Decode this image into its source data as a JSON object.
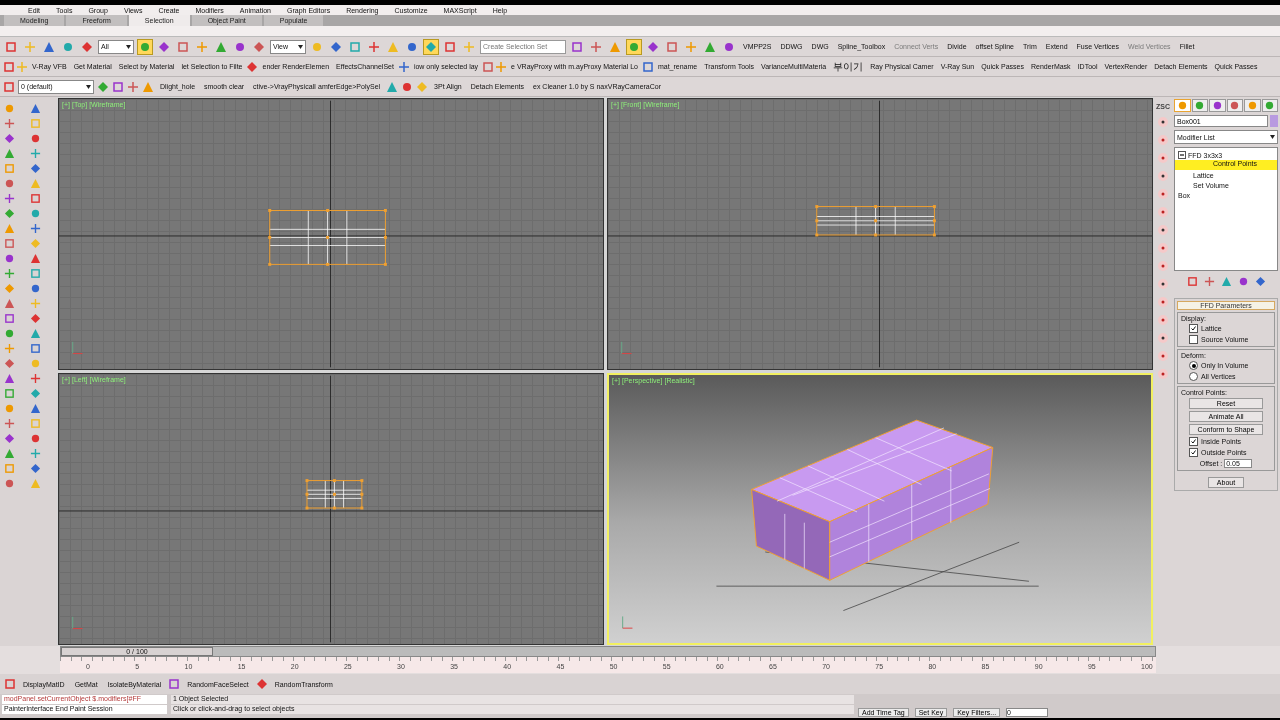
{
  "menu": [
    "Edit",
    "Tools",
    "Group",
    "Views",
    "Create",
    "Modifiers",
    "Animation",
    "Graph Editors",
    "Rendering",
    "Customize",
    "MAXScript",
    "Help"
  ],
  "ribbon_tabs": [
    {
      "label": "Modeling",
      "selected": false
    },
    {
      "label": "Freeform",
      "selected": false
    },
    {
      "label": "Selection",
      "selected": true
    },
    {
      "label": "Object Paint",
      "selected": false
    },
    {
      "label": "Populate",
      "selected": false
    }
  ],
  "main_toolbar": [
    {
      "kind": "icon",
      "selected": false
    },
    {
      "kind": "icon",
      "selected": false
    },
    {
      "kind": "icon",
      "selected": false
    },
    {
      "kind": "icon",
      "selected": false
    },
    {
      "kind": "icon",
      "selected": false
    },
    {
      "kind": "dropdown",
      "value": "All"
    },
    {
      "kind": "icon",
      "selected": true
    },
    {
      "kind": "icon",
      "selected": false
    },
    {
      "kind": "icon",
      "selected": false
    },
    {
      "kind": "icon",
      "selected": false
    },
    {
      "kind": "icon",
      "selected": false
    },
    {
      "kind": "icon",
      "selected": false
    },
    {
      "kind": "icon",
      "selected": false
    },
    {
      "kind": "dropdown",
      "value": "View"
    },
    {
      "kind": "icon",
      "selected": false
    },
    {
      "kind": "icon",
      "selected": false
    },
    {
      "kind": "icon",
      "selected": false
    },
    {
      "kind": "icon",
      "selected": false
    },
    {
      "kind": "icon",
      "selected": false
    },
    {
      "kind": "icon",
      "selected": false
    },
    {
      "kind": "icon",
      "selected": true
    },
    {
      "kind": "icon",
      "selected": false
    },
    {
      "kind": "icon",
      "selected": false
    },
    {
      "kind": "field",
      "placeholder": "Create Selection Set"
    },
    {
      "kind": "icon",
      "selected": false
    },
    {
      "kind": "icon",
      "selected": false
    },
    {
      "kind": "icon",
      "selected": false
    },
    {
      "kind": "icon",
      "selected": true
    },
    {
      "kind": "icon",
      "selected": false
    },
    {
      "kind": "icon",
      "selected": false
    },
    {
      "kind": "icon",
      "selected": false
    },
    {
      "kind": "icon",
      "selected": false
    },
    {
      "kind": "icon",
      "selected": false
    },
    {
      "kind": "button",
      "label": "VMPP2S",
      "disabled": false
    },
    {
      "kind": "button",
      "label": "DDWG",
      "disabled": false
    },
    {
      "kind": "button",
      "label": "DWG",
      "disabled": false
    },
    {
      "kind": "button",
      "label": "Spline_Toolbox",
      "disabled": false
    },
    {
      "kind": "button",
      "label": "Connect Verts",
      "disabled": true
    },
    {
      "kind": "button",
      "label": "Divide",
      "disabled": false
    },
    {
      "kind": "button",
      "label": "offset Spline",
      "disabled": false
    },
    {
      "kind": "button",
      "label": "Trim",
      "disabled": false
    },
    {
      "kind": "button",
      "label": "Extend",
      "disabled": false
    },
    {
      "kind": "button",
      "label": "Fuse Vertices",
      "disabled": false
    },
    {
      "kind": "button",
      "label": "Weld Vertices",
      "disabled": true
    },
    {
      "kind": "button",
      "label": "Fillet",
      "disabled": false
    }
  ],
  "script_toolbar": [
    {
      "kind": "icon"
    },
    {
      "kind": "icon"
    },
    {
      "kind": "button",
      "label": "V-Ray VFB"
    },
    {
      "kind": "button",
      "label": "Get Material"
    },
    {
      "kind": "button",
      "label": "Select by Material"
    },
    {
      "kind": "button",
      "label": "let Selection to Filte"
    },
    {
      "kind": "icon"
    },
    {
      "kind": "button",
      "label": "ender RenderElemen"
    },
    {
      "kind": "button",
      "label": "EffectsChannelSet"
    },
    {
      "kind": "icon"
    },
    {
      "kind": "button",
      "label": "iow only selected lay"
    },
    {
      "kind": "icon"
    },
    {
      "kind": "icon"
    },
    {
      "kind": "button",
      "label": "e VRayProxy with m.ayProxy Material Lo"
    },
    {
      "kind": "icon"
    },
    {
      "kind": "button",
      "label": "mat_rename"
    },
    {
      "kind": "button",
      "label": "Transform Tools"
    },
    {
      "kind": "button",
      "label": "VarianceMultiMateria"
    },
    {
      "kind": "button",
      "label": "부이기"
    },
    {
      "kind": "button",
      "label": "Ray Physical Camer"
    },
    {
      "kind": "button",
      "label": "V-Ray Sun"
    },
    {
      "kind": "button",
      "label": "Quick Passes"
    },
    {
      "kind": "button",
      "label": "RenderMask"
    },
    {
      "kind": "button",
      "label": "IDTool"
    },
    {
      "kind": "button",
      "label": "VertexRender"
    },
    {
      "kind": "button",
      "label": "Detach Elements"
    },
    {
      "kind": "button",
      "label": "Quick Passes"
    }
  ],
  "layer_toolbar": [
    {
      "kind": "icon"
    },
    {
      "kind": "dropdown",
      "value": "0 (default)"
    },
    {
      "kind": "icon"
    },
    {
      "kind": "icon"
    },
    {
      "kind": "icon"
    },
    {
      "kind": "icon"
    },
    {
      "kind": "button",
      "label": "Dlight_hole"
    },
    {
      "kind": "button",
      "label": "smooth clear"
    },
    {
      "kind": "button",
      "label": "ctive->VrayPhysicalI amferEdge>PolySel"
    },
    {
      "kind": "icon"
    },
    {
      "kind": "icon"
    },
    {
      "kind": "icon"
    },
    {
      "kind": "button",
      "label": "3Pt Align"
    },
    {
      "kind": "button",
      "label": "Detach Elements"
    },
    {
      "kind": "button",
      "label": "ex Cleaner 1.0 by S naxVRayCameraCor"
    }
  ],
  "viewports": [
    {
      "labels": [
        "[+]",
        "[Top]",
        "[Wireframe]"
      ],
      "kind": "top",
      "selected": false
    },
    {
      "labels": [
        "[+]",
        "[Front]",
        "[Wireframe]"
      ],
      "kind": "front",
      "selected": false
    },
    {
      "labels": [
        "[+]",
        "[Left]",
        "[Wireframe]"
      ],
      "kind": "left",
      "selected": false
    },
    {
      "labels": [
        "[+]",
        "[Perspective]",
        "[Realistic]"
      ],
      "kind": "perspective",
      "selected": true
    }
  ],
  "side_strip": {
    "label": "ZSC"
  },
  "command_panel": {
    "tabs": [
      {
        "selected": true
      },
      {
        "selected": false
      },
      {
        "selected": false
      },
      {
        "selected": false
      },
      {
        "selected": false
      },
      {
        "selected": false
      }
    ],
    "object_name": "Box001",
    "modifier_list": "Modifier List",
    "stack": [
      {
        "label": "FFD 3x3x3",
        "expanded": true,
        "selected": false,
        "children": [
          {
            "label": "Control Points",
            "selected": true
          },
          {
            "label": "Lattice",
            "selected": false
          },
          {
            "label": "Set Volume",
            "selected": false
          }
        ]
      },
      {
        "label": "Box",
        "selected": false
      }
    ],
    "rollout": {
      "title": "FFD Parameters",
      "groups": [
        {
          "title": "Display:",
          "items": [
            {
              "kind": "checkbox",
              "label": "Lattice",
              "checked": true
            },
            {
              "kind": "checkbox",
              "label": "Source Volume",
              "checked": false
            }
          ]
        },
        {
          "title": "Deform:",
          "items": [
            {
              "kind": "radio",
              "label": "Only In Volume",
              "selected": true
            },
            {
              "kind": "radio",
              "label": "All Vertices",
              "selected": false
            }
          ]
        },
        {
          "title": "Control Points:",
          "items": [
            {
              "kind": "button",
              "label": "Reset"
            },
            {
              "kind": "button",
              "label": "Animate All"
            },
            {
              "kind": "button",
              "label": "Conform to Shape"
            },
            {
              "kind": "checkbox",
              "label": "Inside Points",
              "checked": true
            },
            {
              "kind": "checkbox",
              "label": "Outside Points",
              "checked": true
            },
            {
              "kind": "spinner",
              "label": "Offset :",
              "value": "0.05"
            }
          ]
        }
      ],
      "about": "About"
    }
  },
  "timeline": {
    "slider": "0 / 100",
    "ticks": [
      "0",
      "5",
      "10",
      "15",
      "20",
      "25",
      "30",
      "35",
      "40",
      "45",
      "50",
      "55",
      "60",
      "65",
      "70",
      "75",
      "80",
      "85",
      "90",
      "95",
      "100"
    ]
  },
  "bottom_toolbar": [
    {
      "kind": "icon"
    },
    {
      "kind": "button",
      "label": "DisplayMatID"
    },
    {
      "kind": "button",
      "label": "GetMat"
    },
    {
      "kind": "button",
      "label": "IsolateByMaterial"
    },
    {
      "kind": "icon"
    },
    {
      "kind": "button",
      "label": "RandomFaceSelect"
    },
    {
      "kind": "icon"
    },
    {
      "kind": "button",
      "label": "RandomTransform"
    }
  ],
  "status": {
    "listener_input": "modPanel.setCurrentObject $.modifiers[#FF",
    "listener_output": "PainterInterface End Paint Session",
    "selection": "1 Object Selected",
    "prompt": "Click or click-and-drag to select objects",
    "time_tag": "Add Time Tag",
    "set_key": "Set Key",
    "key_filters": "Key Filters...",
    "frame": "0"
  }
}
